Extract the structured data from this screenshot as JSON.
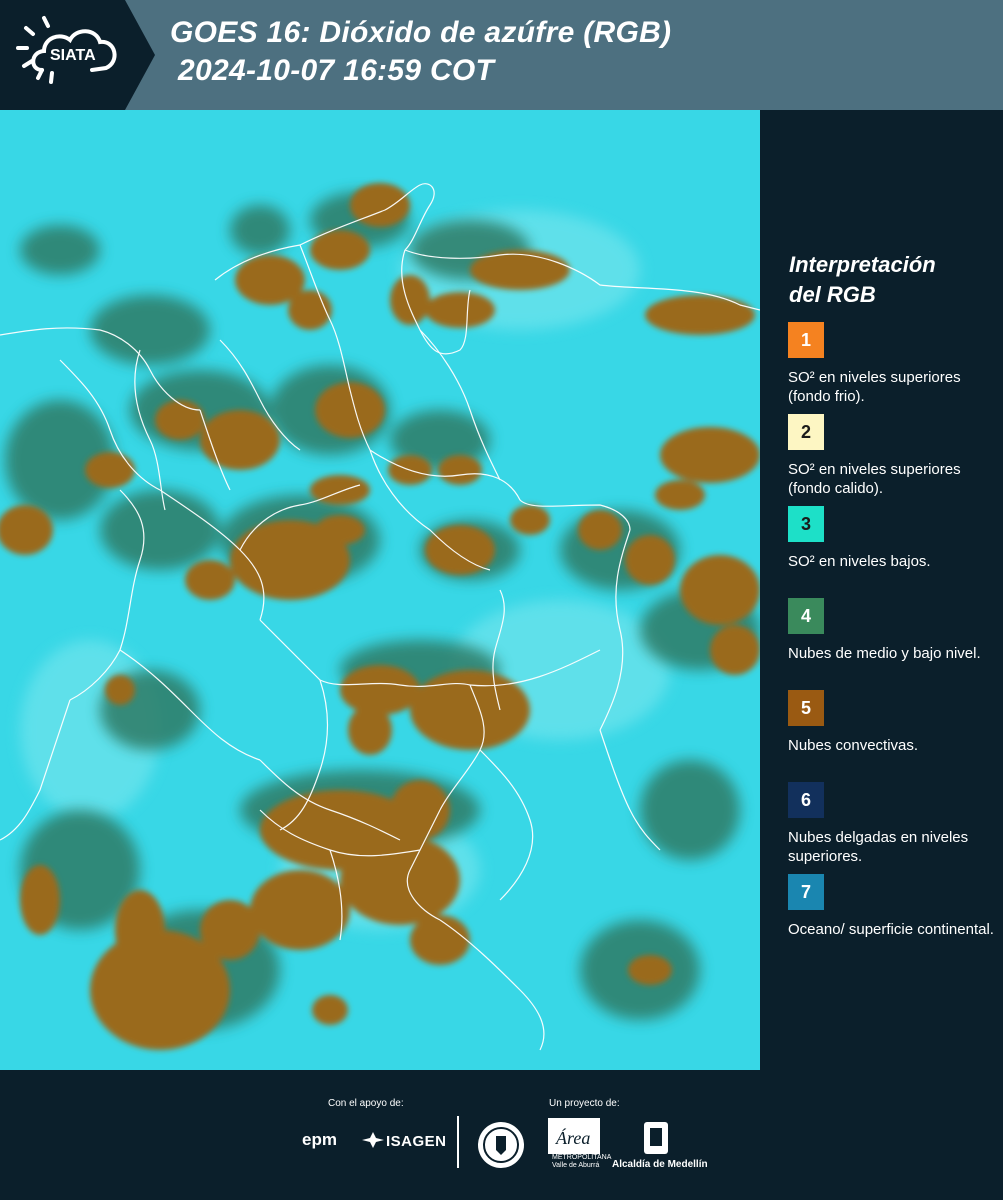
{
  "header": {
    "logo_text": "SIATA",
    "title_line1": "GOES 16: Dióxido de azúfre (RGB)",
    "title_line2": "2024-10-07 16:59 COT"
  },
  "legend": {
    "title_line1": "Interpretación",
    "title_line2": "del RGB",
    "items": [
      {
        "number": "1",
        "color": "#f58220",
        "label": "SO² en niveles superiores (fondo frio)."
      },
      {
        "number": "2",
        "color": "#fdf6c3",
        "label": "SO² en niveles superiores (fondo calido)."
      },
      {
        "number": "3",
        "color": "#1de0c8",
        "label": "SO² en niveles bajos."
      },
      {
        "number": "4",
        "color": "#3a8a5c",
        "label": "Nubes de medio y bajo nivel."
      },
      {
        "number": "5",
        "color": "#9a5a12",
        "label": "Nubes convectivas."
      },
      {
        "number": "6",
        "color": "#12305c",
        "label": "Nubes delgadas en niveles superiores."
      },
      {
        "number": "7",
        "color": "#1a86b0",
        "label": "Oceano/ superficie continental."
      }
    ]
  },
  "footer": {
    "support_label": "Con el apoyo de:",
    "project_label": "Un proyecto de:",
    "epm": "epm",
    "isagen": "ISAGEN",
    "area_title": "Área",
    "area_caption_1": "METROPOLITANA",
    "area_caption_2": "Valle de Aburrá",
    "alcaldia": "Alcaldía de Medellín"
  },
  "colors": {
    "background": "#0b1f2b",
    "header": "#4d7080",
    "ocean_cyan": "#35d6e6",
    "convective": "#9a6a1e",
    "low_cloud": "#3f8c6a"
  }
}
